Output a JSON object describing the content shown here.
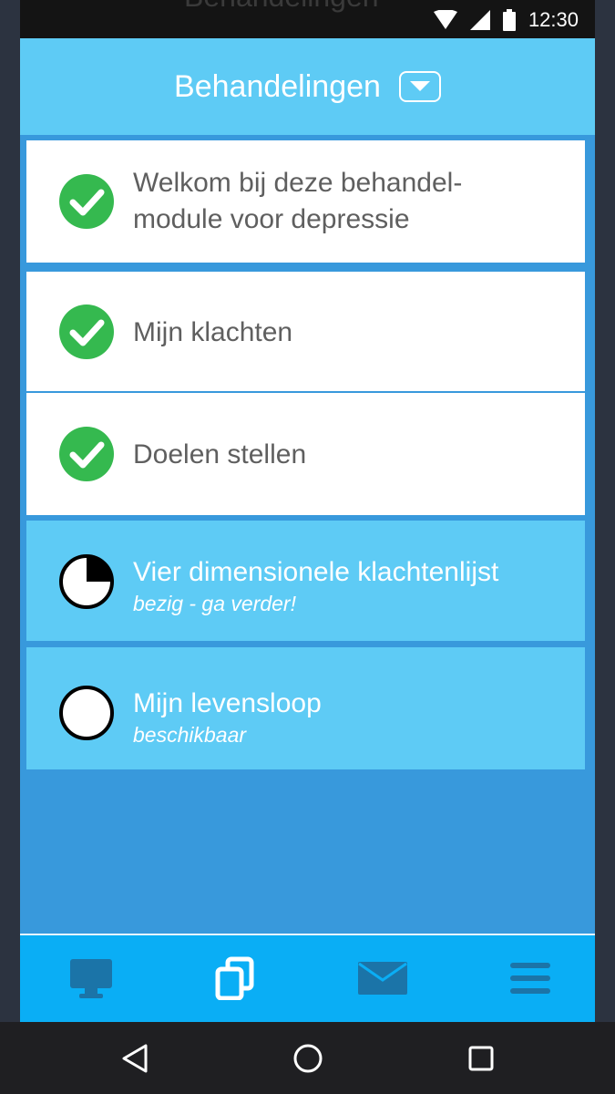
{
  "status_bar": {
    "behind_text": "Behandelingen",
    "time": "12:30",
    "icons": [
      "wifi-icon",
      "signal-icon",
      "battery-icon"
    ]
  },
  "header": {
    "title": "Behandelingen",
    "dropdown_icon": "dropdown-arrow-icon"
  },
  "modules": [
    {
      "title": "Welkom bij deze behandel-module voor depressie",
      "status": "done",
      "icon": "check-circle-icon"
    },
    {
      "title": "Mijn klachten",
      "status": "done",
      "icon": "check-circle-icon"
    },
    {
      "title": "Doelen stellen",
      "status": "done",
      "icon": "check-circle-icon"
    },
    {
      "title": "Vier dimensionele klachtenlijst",
      "subtitle": "bezig - ga verder!",
      "status": "in-progress",
      "progress": 0.25,
      "icon": "progress-pie-icon"
    },
    {
      "title": "Mijn levensloop",
      "subtitle": "beschikbaar",
      "status": "available",
      "icon": "empty-circle-icon"
    }
  ],
  "bottom_nav": [
    "monitor-icon",
    "copy-icon",
    "mail-icon",
    "menu-icon"
  ],
  "system_nav": [
    "back-icon",
    "home-icon",
    "recents-icon"
  ],
  "colors": {
    "header": "#5ecbf5",
    "background": "#3899dc",
    "done_row": "#ffffff",
    "open_row": "#5ecbf5",
    "check": "#35b94f",
    "nav": "#0aaef5"
  }
}
